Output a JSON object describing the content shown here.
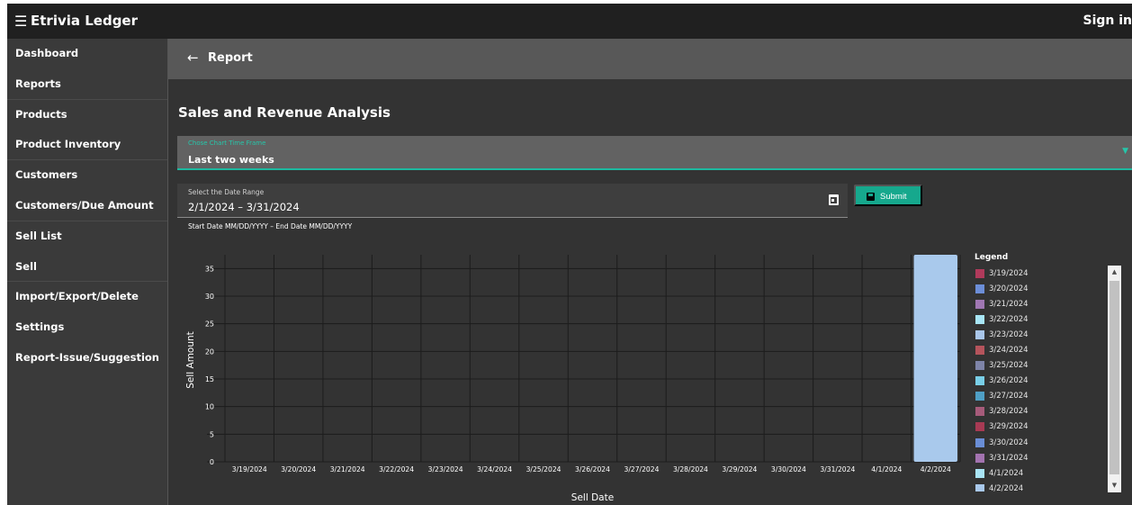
{
  "app": {
    "menu_icon": "menu-collapse-icon",
    "title": "Etrivia Ledger",
    "sign_in": "Sign in"
  },
  "sidebar": {
    "items": [
      {
        "label": "Dashboard"
      },
      {
        "label": "Reports"
      },
      {
        "label": "Products"
      },
      {
        "label": "Product Inventory"
      },
      {
        "label": "Customers"
      },
      {
        "label": "Customers/Due Amount"
      },
      {
        "label": "Sell List"
      },
      {
        "label": "Sell"
      },
      {
        "label": "Import/Export/Delete"
      },
      {
        "label": "Settings"
      },
      {
        "label": "Report-Issue/Suggestion"
      }
    ]
  },
  "header": {
    "back_icon": "arrow-left-icon",
    "title": "Report"
  },
  "main": {
    "title": "Sales and Revenue Analysis",
    "timeframe": {
      "label": "Chose Chart Time Frame",
      "value": "Last two weeks"
    },
    "daterange": {
      "label": "Select the Date Range",
      "value": "2/1/2024 – 3/31/2024",
      "hint": "Start Date MM/DD/YYYY – End Date MM/DD/YYYY",
      "icon": "calendar-icon"
    },
    "submit": {
      "label": "Submit",
      "icon": "save-icon"
    }
  },
  "chart_data": {
    "type": "bar",
    "xlabel": "Sell Date",
    "ylabel": "Sell Amount",
    "ylim": [
      0,
      37.5
    ],
    "yticks": [
      0,
      5,
      10,
      15,
      20,
      25,
      30,
      35
    ],
    "grid": true,
    "categories": [
      "3/19/2024",
      "3/20/2024",
      "3/21/2024",
      "3/22/2024",
      "3/23/2024",
      "3/24/2024",
      "3/25/2024",
      "3/26/2024",
      "3/27/2024",
      "3/28/2024",
      "3/29/2024",
      "3/30/2024",
      "3/31/2024",
      "4/1/2024",
      "4/2/2024"
    ],
    "values": [
      0,
      0,
      0,
      0,
      0,
      0,
      0,
      0,
      0,
      0,
      0,
      0,
      0,
      0,
      37.5
    ],
    "colors": [
      "#b03a5b",
      "#6c8ed8",
      "#a077b3",
      "#a8e6f7",
      "#a9c6ea",
      "#b5545c",
      "#7e84a8",
      "#79cfe8",
      "#4f9fc5",
      "#a65b7a",
      "#a83a54",
      "#6a8ed6",
      "#a373b0",
      "#a9e4f5",
      "#a9c9ec"
    ],
    "legend": {
      "title": "Legend",
      "position": "right",
      "entries": [
        "3/19/2024",
        "3/20/2024",
        "3/21/2024",
        "3/22/2024",
        "3/23/2024",
        "3/24/2024",
        "3/25/2024",
        "3/26/2024",
        "3/27/2024",
        "3/28/2024",
        "3/29/2024",
        "3/30/2024",
        "3/31/2024",
        "4/1/2024",
        "4/2/2024"
      ]
    }
  }
}
